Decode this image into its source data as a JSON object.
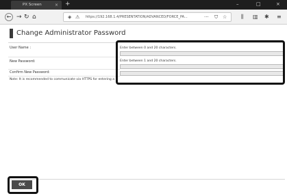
{
  "browser": {
    "tab_title": "PX Screen",
    "tab_close": "×",
    "new_tab": "+",
    "url": "https://192.168.1.4/PRESENTATION/ADVANCED/FORCE_PA...",
    "url_more": "···",
    "window_controls": [
      "–",
      "□",
      "×"
    ],
    "nav_icons": [
      "arrow-left-icon",
      "arrow-right-icon",
      "reload-icon",
      "home-icon"
    ],
    "toolbar_icons": [
      "library-icon",
      "sidebar-icon",
      "extension-icon",
      "menu-icon"
    ]
  },
  "page": {
    "title": "Change Administrator Password",
    "fields": [
      {
        "label": "User Name :",
        "hint": "Enter between 0 and 20 characters.",
        "value": ""
      },
      {
        "label": "New Password:",
        "hint": "Enter between 1 and 20 characters.",
        "value": ""
      },
      {
        "label": "Confirm New Password:",
        "value": ""
      }
    ],
    "note": "Note: It is recommended to communicate via HTTPS for entering a",
    "ok_label": "OK"
  },
  "colors": {
    "chrome_dark": "#1e1e1e",
    "toolbar_bg": "#f1f1f1",
    "button_bg": "#4a4a4a",
    "highlight": "#111111"
  }
}
